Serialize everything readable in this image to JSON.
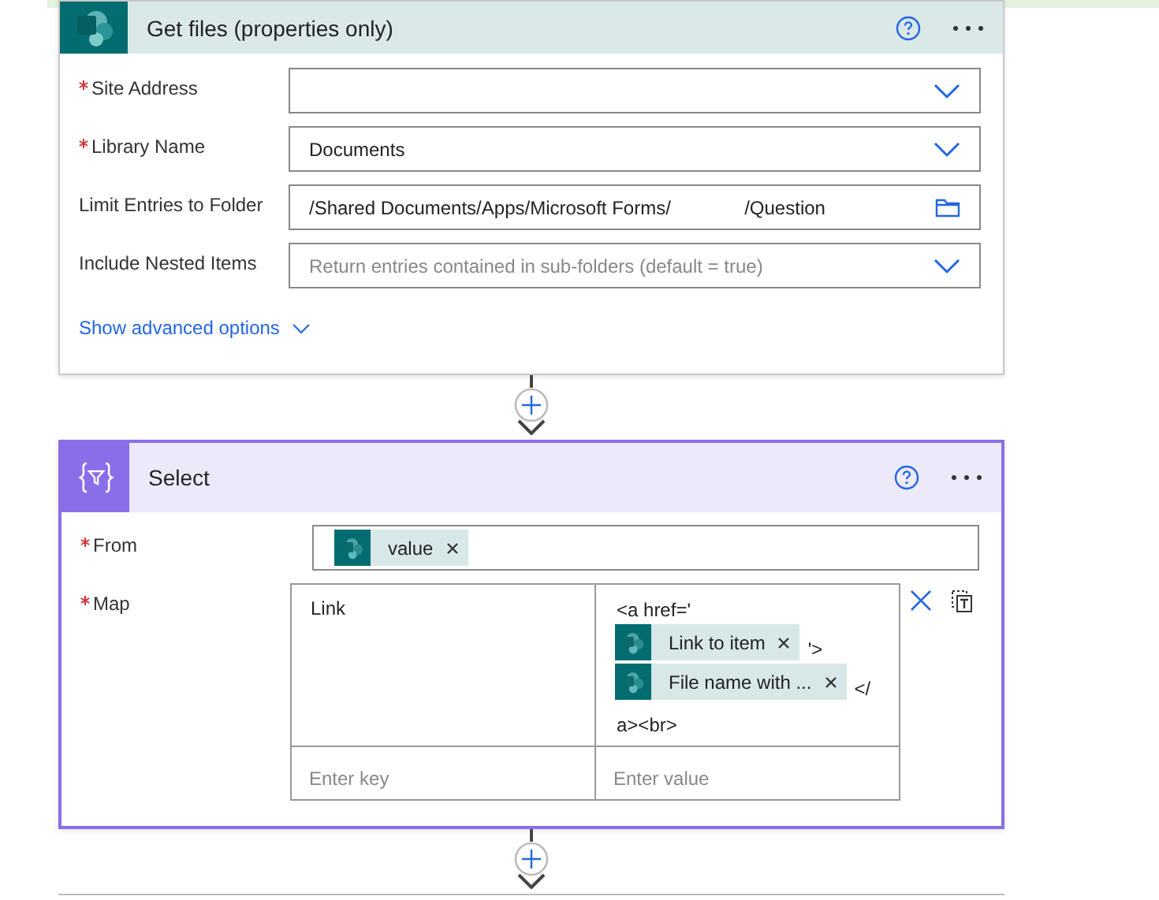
{
  "cards": [
    {
      "kind": "sharepoint",
      "title": "Get files (properties only)",
      "fields": [
        {
          "label": "Site Address",
          "required": true,
          "kind": "dropdown"
        },
        {
          "label": "Library Name",
          "required": true,
          "kind": "dropdown",
          "value": "Documents"
        },
        {
          "label": "Limit Entries to Folder",
          "required": false,
          "kind": "folder",
          "value": "/Shared Documents/Apps/Microsoft Forms/              /Question"
        },
        {
          "label": "Include Nested Items",
          "required": false,
          "kind": "dropdown",
          "placeholder": "Return entries contained in sub-folders (default = true)"
        }
      ],
      "advanced_link": "Show advanced options"
    },
    {
      "kind": "select",
      "title": "Select",
      "fields": [
        {
          "label": "From",
          "required": true,
          "kind": "tokens",
          "tokens": [
            {
              "label": "value"
            }
          ]
        },
        {
          "label": "Map",
          "required": true,
          "kind": "map",
          "rows": [
            {
              "key": "Link",
              "value_lines": [
                [
                  {
                    "kind": "text",
                    "text": "<a href='"
                  }
                ],
                [
                  {
                    "kind": "token",
                    "label": "Link to item"
                  },
                  {
                    "kind": "text",
                    "text": "'>"
                  }
                ],
                [
                  {
                    "kind": "token",
                    "label": "File name with ..."
                  },
                  {
                    "kind": "text",
                    "text": "</"
                  }
                ],
                [
                  {
                    "kind": "text",
                    "text": "a><br>"
                  }
                ]
              ]
            }
          ],
          "key_placeholder": "Enter key",
          "value_placeholder": "Enter value"
        }
      ]
    }
  ]
}
